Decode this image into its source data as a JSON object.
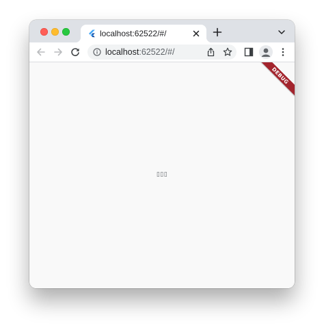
{
  "tab": {
    "title": "localhost:62522/#/",
    "favicon": "flutter-icon"
  },
  "omnibox": {
    "url_host": "localhost",
    "url_path": ":62522/#/"
  },
  "content": {
    "center_text": "▯▯▯",
    "debug_label": "DEBUG"
  },
  "colors": {
    "titlebar": "#dee1e6",
    "toolbar": "#ffffff",
    "content_bg": "#f9f9f9",
    "debug_banner": "#a3242d",
    "flutter_blue": "#42a5f5"
  }
}
